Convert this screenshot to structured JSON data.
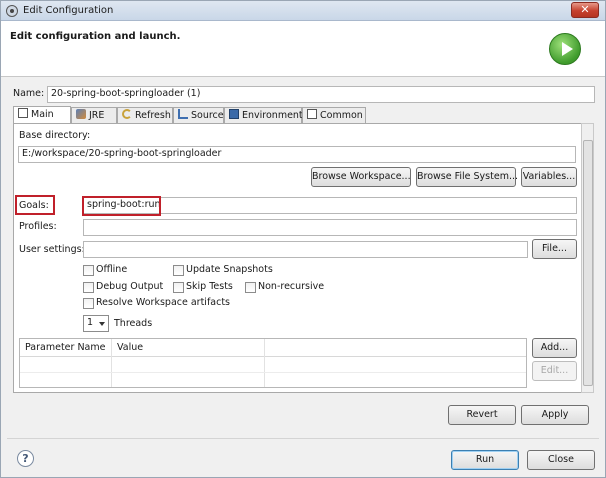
{
  "window": {
    "title": "Edit Configuration",
    "close_glyph": "✕"
  },
  "banner": {
    "title": "Edit configuration and launch."
  },
  "name": {
    "label": "Name:",
    "value": "20-spring-boot-springloader (1)"
  },
  "tabs": [
    {
      "label": "Main",
      "icon": "main-tab-icon"
    },
    {
      "label": "JRE",
      "icon": "jre-icon"
    },
    {
      "label": "Refresh",
      "icon": "refresh-icon"
    },
    {
      "label": "Source",
      "icon": "source-icon"
    },
    {
      "label": "Environment",
      "icon": "environment-icon"
    },
    {
      "label": "Common",
      "icon": "common-icon"
    }
  ],
  "main": {
    "base_directory": {
      "label": "Base directory:",
      "value": "E:/workspace/20-spring-boot-springloader"
    },
    "browse_workspace": "Browse Workspace...",
    "browse_filesystem": "Browse File System...",
    "variables": "Variables...",
    "goals": {
      "label": "Goals:",
      "value": "spring-boot:run"
    },
    "profiles": {
      "label": "Profiles:",
      "value": ""
    },
    "user_settings": {
      "label": "User settings:",
      "value": "",
      "file_button": "File..."
    },
    "options": {
      "offline": "Offline",
      "update_snapshots": "Update Snapshots",
      "debug_output": "Debug Output",
      "skip_tests": "Skip Tests",
      "non_recursive": "Non-recursive",
      "resolve_workspace": "Resolve Workspace artifacts"
    },
    "threads": {
      "value": "1",
      "label": "Threads"
    },
    "params_table": {
      "columns": [
        "Parameter Name",
        "Value"
      ]
    },
    "add_button": "Add...",
    "edit_button": "Edit..."
  },
  "footer": {
    "revert": "Revert",
    "apply": "Apply",
    "run": "Run",
    "close": "Close",
    "help_glyph": "?"
  },
  "colors": {
    "highlight": "#c0202a",
    "run_icon": "#3f9b2c"
  }
}
